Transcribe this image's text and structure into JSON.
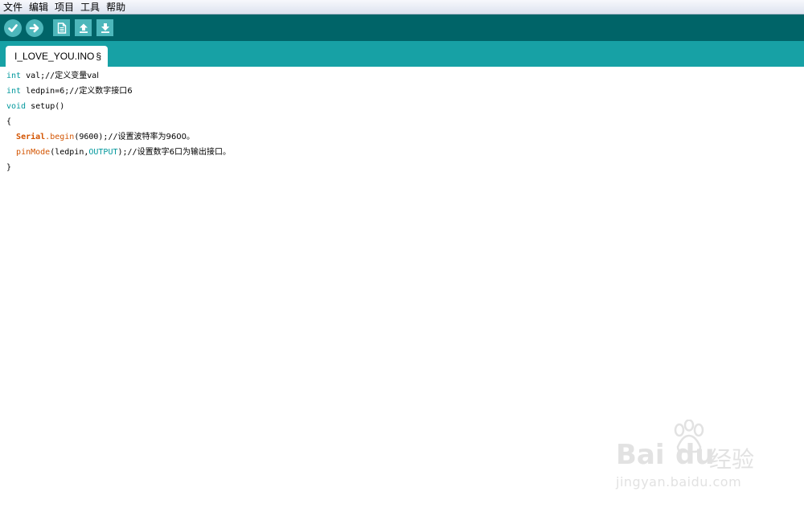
{
  "menubar": {
    "items": [
      "文件",
      "编辑",
      "项目",
      "工具",
      "帮助"
    ]
  },
  "toolbar": {
    "buttons": [
      "verify-icon",
      "upload-icon",
      "new-icon",
      "open-icon",
      "save-icon"
    ]
  },
  "tab": {
    "label": "I_LOVE_YOU.INO",
    "modified_marker": "§"
  },
  "code": {
    "line1": {
      "type": "int",
      "rest": " val;//",
      "comment": "定义变量val"
    },
    "line2": {
      "type": "int",
      "rest": " ledpin=6;//",
      "comment": "定义数字接口6"
    },
    "line3": {
      "type": "void",
      "rest": " setup()"
    },
    "line4": {
      "text": "{"
    },
    "line5": {
      "cls": "Serial",
      "dot": ".",
      "fn": "begin",
      "rest": "(9600);//",
      "comment": "设置波特率为9600。"
    },
    "line6": {
      "fn": "pinMode",
      "arg": "(ledpin,",
      "const": "OUTPUT",
      "rest": ");//",
      "comment": "设置数字6口为输出接口。"
    },
    "line7": {
      "text": "}"
    }
  },
  "watermark": {
    "brand": "Bai",
    "brand2": "du",
    "name": "经验",
    "url": "jingyan.baidu.com"
  },
  "colors": {
    "toolbar_bg": "#006468",
    "tabstrip_bg": "#17a1a5",
    "button_bg": "#4db7bb",
    "keyword": "#00979c",
    "function": "#d35400"
  }
}
